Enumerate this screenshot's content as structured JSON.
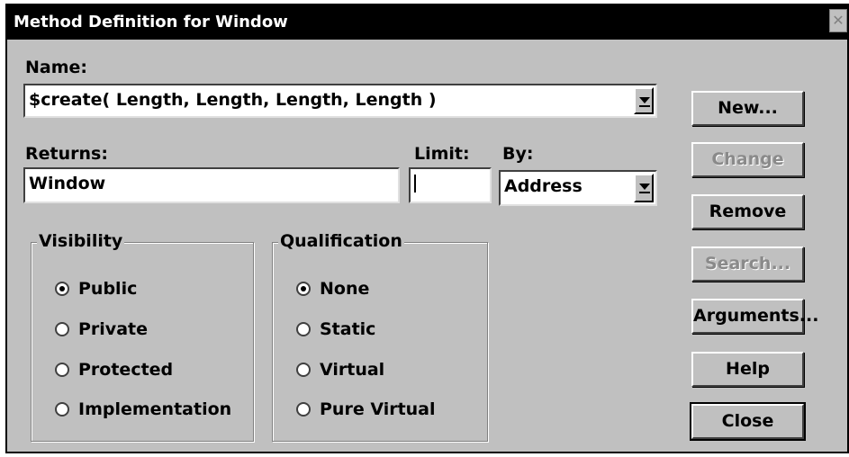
{
  "window": {
    "title": "Method Definition for Window",
    "close_glyph": "✕"
  },
  "name_field": {
    "label": "Name:",
    "value": "$create( Length, Length, Length, Length )"
  },
  "returns_field": {
    "label": "Returns:",
    "value": "Window"
  },
  "limit_field": {
    "label": "Limit:",
    "value": ""
  },
  "by_field": {
    "label": "By:",
    "value": "Address"
  },
  "visibility": {
    "legend": "Visibility",
    "options": [
      {
        "label": "Public",
        "checked": true
      },
      {
        "label": "Private",
        "checked": false
      },
      {
        "label": "Protected",
        "checked": false
      },
      {
        "label": "Implementation",
        "checked": false
      }
    ]
  },
  "qualification": {
    "legend": "Qualification",
    "options": [
      {
        "label": "None",
        "checked": true
      },
      {
        "label": "Static",
        "checked": false
      },
      {
        "label": "Virtual",
        "checked": false
      },
      {
        "label": "Pure Virtual",
        "checked": false
      }
    ]
  },
  "buttons": {
    "new": "New...",
    "change": "Change",
    "remove": "Remove",
    "search": "Search...",
    "arguments": "Arguments...",
    "help": "Help",
    "close": "Close"
  },
  "colors": {
    "face": "#c0c0c0",
    "titlebar": "#000000",
    "disabled_text": "#8a8a8a"
  }
}
